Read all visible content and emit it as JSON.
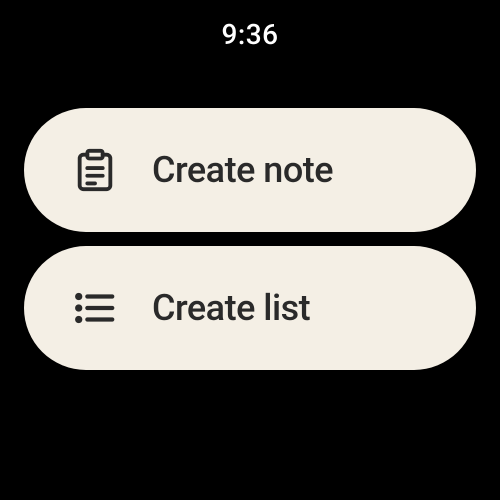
{
  "clock": "9:36",
  "actions": [
    {
      "label": "Create note"
    },
    {
      "label": "Create list"
    }
  ]
}
